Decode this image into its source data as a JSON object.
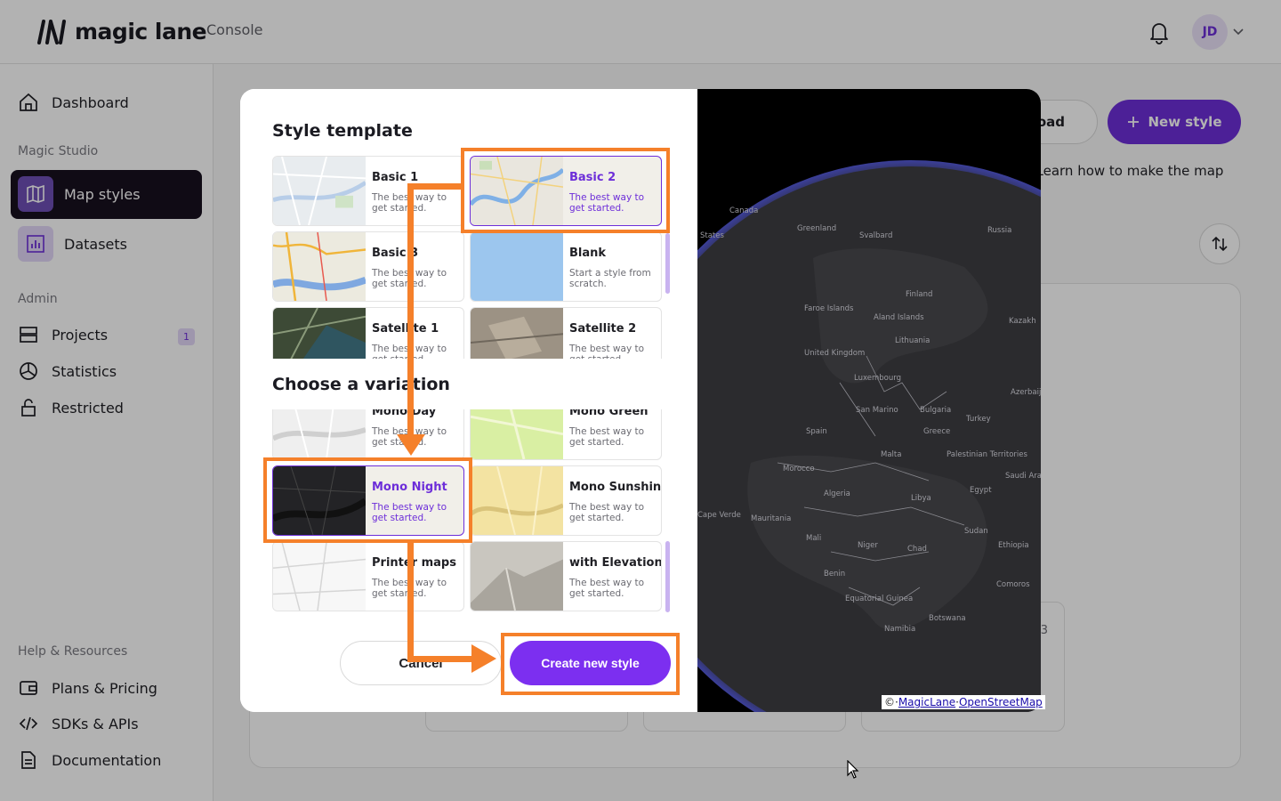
{
  "header": {
    "logo": "magic lane",
    "subtitle": "Console",
    "user_initials": "JD"
  },
  "sidebar": {
    "dashboard": "Dashboard",
    "section_studio": "Magic Studio",
    "map_styles": "Map styles",
    "datasets": "Datasets",
    "section_admin": "Admin",
    "projects": "Projects",
    "projects_badge": "1",
    "statistics": "Statistics",
    "restricted": "Restricted",
    "section_help": "Help & Resources",
    "plans": "Plans & Pricing",
    "sdks": "SDKs & APIs",
    "docs": "Documentation"
  },
  "main": {
    "upload_label": "load",
    "new_style_label": "New style",
    "description": "form. Learn how to make the map",
    "card_count": "3"
  },
  "modal": {
    "template_heading": "Style template",
    "variation_heading": "Choose a variation",
    "templates": [
      {
        "title": "Basic 1",
        "desc": "The best way to get started."
      },
      {
        "title": "Basic 2",
        "desc": "The best way to get started."
      },
      {
        "title": "Basic 3",
        "desc": "The best way to get started."
      },
      {
        "title": "Blank",
        "desc": "Start a style from scratch."
      },
      {
        "title": "Satellite 1",
        "desc": "The best way to get started."
      },
      {
        "title": "Satellite 2",
        "desc": "The best way to get started."
      }
    ],
    "variations": [
      {
        "title": "Mono Day",
        "desc": "The best way to get started."
      },
      {
        "title": "Mono Green",
        "desc": "The best way to get started."
      },
      {
        "title": "Mono Night",
        "desc": "The best way to get started."
      },
      {
        "title": "Mono Sunshine",
        "desc": "The best way to get started."
      },
      {
        "title": "Printer maps",
        "desc": "The best way to get started."
      },
      {
        "title": "with Elevation",
        "desc": "The best way to get started."
      }
    ],
    "cancel_label": "Cancel",
    "create_label": "Create new style",
    "map_labels": [
      "Canada",
      "States",
      "Greenland",
      "Svalbard",
      "Russia",
      "Finland",
      "Faroe Islands",
      "Aland Islands",
      "United Kingdom",
      "Lithuania",
      "Luxembourg",
      "Kazakh",
      "San Marino",
      "Bulgaria",
      "Azerbaijan",
      "Spain",
      "Greece",
      "Turkey",
      "Malta",
      "Palestinian Territories",
      "Morocco",
      "Egypt",
      "Saudi Arab",
      "Algeria",
      "Libya",
      "Cape Verde",
      "Mauritania",
      "Sudan",
      "Mali",
      "Niger",
      "Chad",
      "Ethiopia",
      "Benin",
      "Comoros",
      "Equatorial Guinea",
      "Botswana",
      "Namibia"
    ],
    "attribution": {
      "prefix": "©",
      "magiclane": "MagicLane",
      "sep": "·",
      "osm": "OpenStreetMap"
    }
  },
  "colors": {
    "accent": "#6d2ed9",
    "annotation": "#f5802a",
    "create": "#7c2ff0"
  }
}
